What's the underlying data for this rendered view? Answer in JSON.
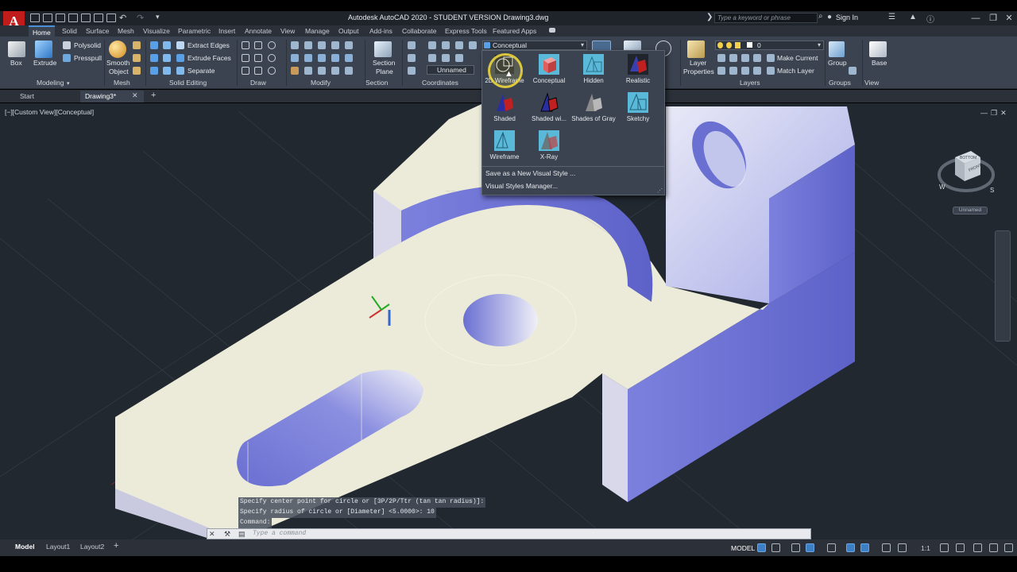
{
  "title": {
    "app_text": "Autodesk AutoCAD 2020 - STUDENT VERSION    Drawing3.dwg",
    "search_placeholder": "Type a keyword or phrase",
    "sign_in": "Sign In",
    "app_button": "A"
  },
  "ribbon_tabs": [
    "Home",
    "Solid",
    "Surface",
    "Mesh",
    "Visualize",
    "Parametric",
    "Insert",
    "Annotate",
    "View",
    "Manage",
    "Output",
    "Add-ins",
    "Collaborate",
    "Express Tools",
    "Featured Apps"
  ],
  "ribbon": {
    "modeling": {
      "title": "Modeling",
      "box": "Box",
      "extrude": "Extrude",
      "polysolid": "Polysolid",
      "presspull": "Presspull"
    },
    "mesh": {
      "title": "Mesh",
      "smooth": "Smooth",
      "object": "Object"
    },
    "solid_editing": {
      "title": "Solid Editing",
      "extract_edges": "Extract Edges",
      "extrude_faces": "Extrude Faces",
      "separate": "Separate"
    },
    "draw": {
      "title": "Draw"
    },
    "modify": {
      "title": "Modify"
    },
    "section": {
      "title": "Section",
      "section_plane_1": "Section",
      "section_plane_2": "Plane"
    },
    "coordinates": {
      "title": "Coordinates",
      "ucs_combo": "Unnamed"
    },
    "view": {
      "visual_style_combo": "Conceptual",
      "title": "View"
    },
    "layers": {
      "title": "Layers",
      "layer_properties_1": "Layer",
      "layer_properties_2": "Properties",
      "make_current": "Make Current",
      "match_layer": "Match Layer",
      "layer_combo": "0"
    },
    "groups": {
      "title": "Groups",
      "group": "Group"
    },
    "base": {
      "title": "View",
      "base": "Base"
    }
  },
  "doc_tabs": {
    "start": "Start",
    "drawing": "Drawing3*"
  },
  "viewport": {
    "label": "[−][Custom View][Conceptual]",
    "viewcube_caption": "Unnamed",
    "viewcube_top": "BOTTOM",
    "viewcube_front": "FRONT",
    "compass_w": "W",
    "compass_s": "S"
  },
  "visual_styles_gallery": {
    "items": [
      {
        "label": "2D Wireframe"
      },
      {
        "label": "Conceptual"
      },
      {
        "label": "Hidden"
      },
      {
        "label": "Realistic"
      },
      {
        "label": "Shaded"
      },
      {
        "label": "Shaded wi..."
      },
      {
        "label": "Shades of Gray"
      },
      {
        "label": "Sketchy"
      },
      {
        "label": "Wireframe"
      },
      {
        "label": "X-Ray"
      }
    ],
    "save_as": "Save as a New Visual Style ...",
    "manager": "Visual Styles Manager..."
  },
  "command": {
    "history": [
      "Specify center point for circle or [3P/2P/Ttr (tan tan radius)]:",
      "Specify radius of circle or [Diameter] <5.0000>: 10",
      "Command:"
    ],
    "input_placeholder": "Type a command"
  },
  "status": {
    "tabs": [
      "Model",
      "Layout1",
      "Layout2"
    ],
    "model_space": "MODEL",
    "scale": "1:1"
  },
  "colors": {
    "viewport_bg": "#212830",
    "ribbon_bg": "#3b4350",
    "solid_face_top": "#ecebd9",
    "solid_face_blue": "#6a70d0",
    "app_button": "#c01c1c"
  }
}
